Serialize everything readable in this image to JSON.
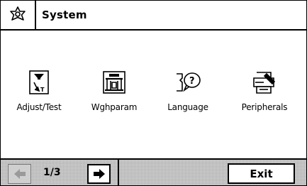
{
  "header": {
    "title": "System",
    "icon": "flower-settings-icon"
  },
  "apps": [
    {
      "label": "Adjust/Test",
      "icon": "adjust-test-weight-icon"
    },
    {
      "label": "Wghparam",
      "icon": "weighing-parameters-icon"
    },
    {
      "label": "Language",
      "icon": "language-speech-icon"
    },
    {
      "label": "Peripherals",
      "icon": "peripherals-printer-icon"
    }
  ],
  "footer": {
    "page_indicator": "1/3",
    "prev_icon": "arrow-left-icon",
    "next_icon": "arrow-right-icon",
    "exit_label": "Exit"
  }
}
